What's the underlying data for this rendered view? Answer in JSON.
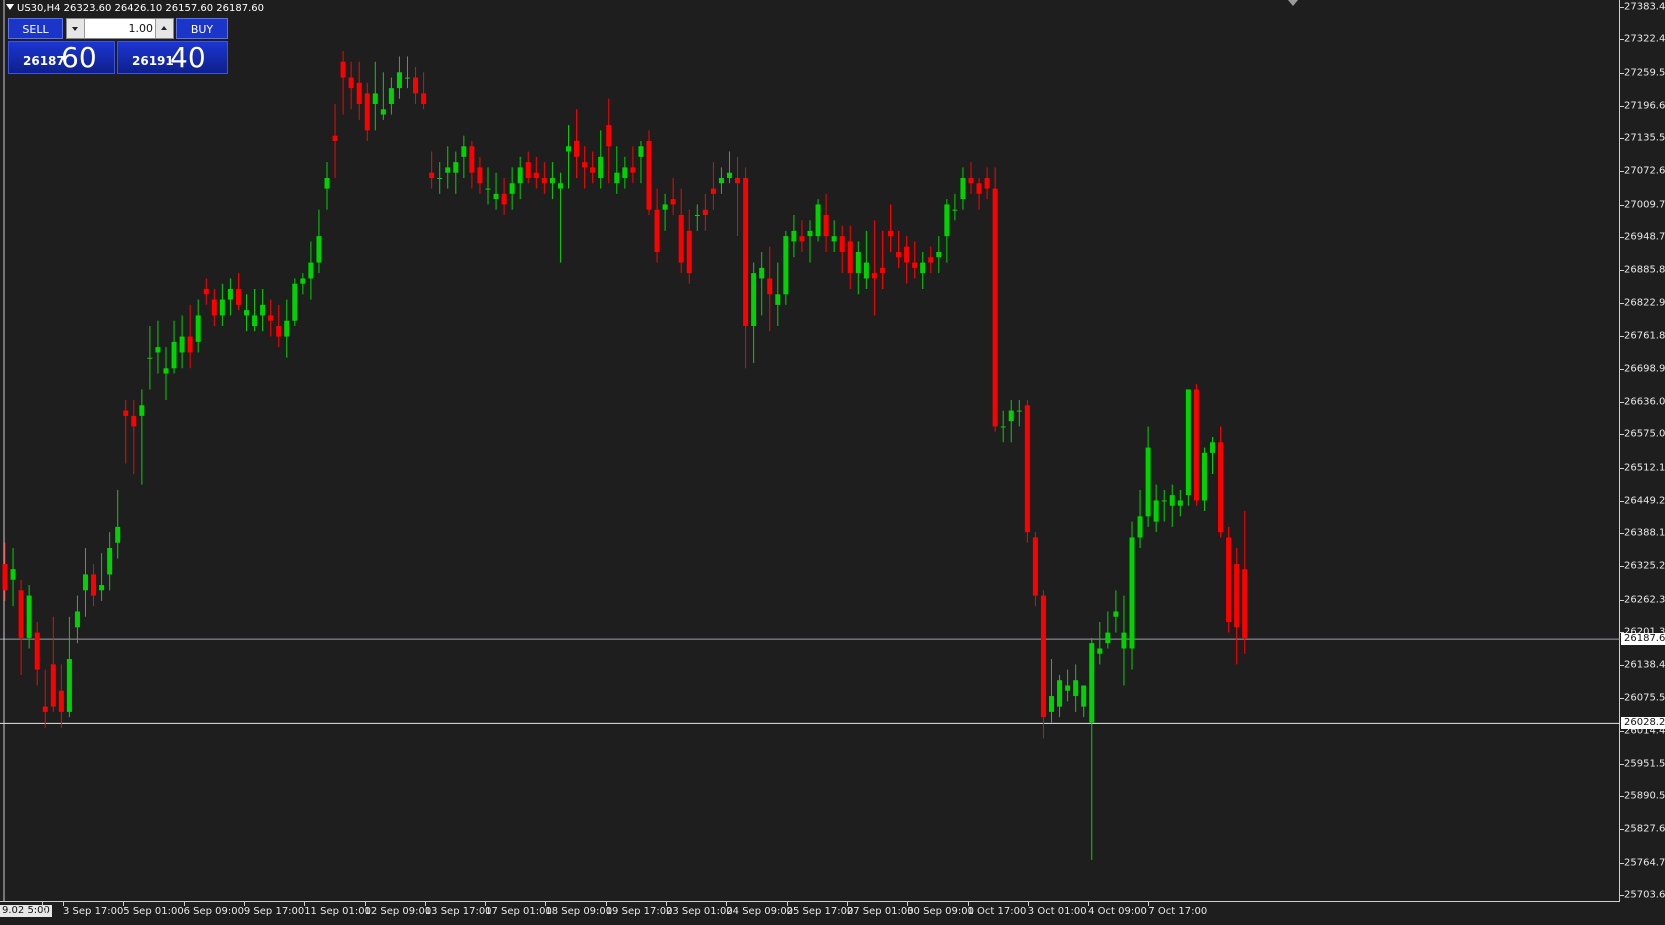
{
  "symbol_info": {
    "text": "US30,H4  26323.60 26426.10 26157.60 26187.60"
  },
  "trade_panel": {
    "sell_label": "SELL",
    "buy_label": "BUY",
    "lot_value": "1.00",
    "sell_price_small": "26187",
    "sell_price_big": "60",
    "buy_price_small": "26191",
    "buy_price_big": "40"
  },
  "colors": {
    "background": "#1e1e1e",
    "bull": "#00d400",
    "bear": "#ff0000",
    "axis": "#cfcfcf",
    "panel_blue": "#1a35c8"
  },
  "period_separator_label": "9.02 5:00",
  "price_axis": {
    "labels": [
      "27383.45",
      "27322.40",
      "27259.50",
      "27196.60",
      "27135.55",
      "27072.60",
      "27009.75",
      "26948.70",
      "26885.80",
      "26822.90",
      "26761.85",
      "26698.95",
      "26636.05",
      "26575.00",
      "26512.10",
      "26449.20",
      "26388.15",
      "26325.25",
      "26262.35",
      "26201.30",
      "26138.40",
      "26075.50",
      "26014.45",
      "25951.55",
      "25890.50",
      "25827.60",
      "25764.70",
      "25703.65"
    ],
    "bid_marker": "26187.60",
    "hline_marker": "26028.28"
  },
  "time_axis": {
    "labels": [
      "9",
      "3 Sep 17:00",
      "5 Sep 01:00",
      "6 Sep 09:00",
      "9 Sep 17:00",
      "11 Sep 01:00",
      "12 Sep 09:00",
      "13 Sep 17:00",
      "17 Sep 01:00",
      "18 Sep 09:00",
      "19 Sep 17:00",
      "23 Sep 01:00",
      "24 Sep 09:00",
      "25 Sep 17:00",
      "27 Sep 01:00",
      "30 Sep 09:00",
      "1 Oct 17:00",
      "3 Oct 01:00",
      "4 Oct 09:00",
      "7 Oct 17:00"
    ]
  },
  "chart_data": {
    "type": "candlestick",
    "symbol": "US30",
    "timeframe": "H4",
    "ylim": [
      25703.65,
      27383.45
    ],
    "horizontal_lines": [
      26187.6,
      26028.28
    ],
    "ohlc": [
      [
        26330,
        26370,
        26260,
        26280
      ],
      [
        26300,
        26360,
        26250,
        26320
      ],
      [
        26280,
        26300,
        26120,
        26190
      ],
      [
        26190,
        26290,
        26170,
        26270
      ],
      [
        26200,
        26220,
        26100,
        26130
      ],
      [
        26060,
        26130,
        26020,
        26050
      ],
      [
        26140,
        26230,
        26050,
        26060
      ],
      [
        26090,
        26140,
        26020,
        26050
      ],
      [
        26050,
        26230,
        26040,
        26150
      ],
      [
        26210,
        26270,
        26180,
        26240
      ],
      [
        26280,
        26360,
        26230,
        26310
      ],
      [
        26310,
        26330,
        26250,
        26270
      ],
      [
        26280,
        26350,
        26260,
        26290
      ],
      [
        26310,
        26390,
        26280,
        26360
      ],
      [
        26370,
        26470,
        26340,
        26400
      ],
      [
        26620,
        26640,
        26520,
        26610
      ],
      [
        26610,
        26640,
        26500,
        26590
      ],
      [
        26610,
        26660,
        26480,
        26630
      ],
      [
        26720,
        26780,
        26660,
        26720
      ],
      [
        26730,
        26790,
        26690,
        26740
      ],
      [
        26690,
        26740,
        26640,
        26700
      ],
      [
        26700,
        26790,
        26690,
        26750
      ],
      [
        26730,
        26800,
        26700,
        26760
      ],
      [
        26760,
        26820,
        26700,
        26730
      ],
      [
        26750,
        26830,
        26730,
        26800
      ],
      [
        26850,
        26870,
        26820,
        26840
      ],
      [
        26830,
        26850,
        26780,
        26800
      ],
      [
        26800,
        26860,
        26780,
        26830
      ],
      [
        26830,
        26870,
        26800,
        26850
      ],
      [
        26850,
        26880,
        26810,
        26820
      ],
      [
        26800,
        26840,
        26770,
        26810
      ],
      [
        26780,
        26850,
        26770,
        26800
      ],
      [
        26800,
        26850,
        26770,
        26820
      ],
      [
        26800,
        26830,
        26760,
        26790
      ],
      [
        26780,
        26820,
        26740,
        26760
      ],
      [
        26760,
        26830,
        26720,
        26790
      ],
      [
        26790,
        26870,
        26780,
        26860
      ],
      [
        26860,
        26880,
        26840,
        26870
      ],
      [
        26870,
        26940,
        26830,
        26900
      ],
      [
        26900,
        27000,
        26880,
        26950
      ],
      [
        27040,
        27090,
        27000,
        27060
      ],
      [
        27140,
        27200,
        27060,
        27130
      ],
      [
        27280,
        27300,
        27180,
        27250
      ],
      [
        27250,
        27280,
        27190,
        27230
      ],
      [
        27240,
        27280,
        27170,
        27200
      ],
      [
        27220,
        27240,
        27130,
        27150
      ],
      [
        27200,
        27280,
        27150,
        27220
      ],
      [
        27180,
        27260,
        27170,
        27190
      ],
      [
        27200,
        27250,
        27180,
        27230
      ],
      [
        27230,
        27290,
        27210,
        27260
      ],
      [
        27250,
        27290,
        27230,
        27250
      ],
      [
        27250,
        27270,
        27200,
        27220
      ],
      [
        27220,
        27260,
        27190,
        27200
      ],
      [
        27070,
        27110,
        27040,
        27060
      ],
      [
        27060,
        27090,
        27030,
        27060
      ],
      [
        27070,
        27120,
        27040,
        27080
      ],
      [
        27070,
        27110,
        27030,
        27090
      ],
      [
        27100,
        27140,
        27060,
        27120
      ],
      [
        27120,
        27130,
        27040,
        27070
      ],
      [
        27080,
        27100,
        27030,
        27050
      ],
      [
        27040,
        27080,
        27010,
        27040
      ],
      [
        27020,
        27070,
        27000,
        27030
      ],
      [
        27030,
        27060,
        26990,
        27010
      ],
      [
        27030,
        27080,
        27000,
        27050
      ],
      [
        27050,
        27100,
        27020,
        27080
      ],
      [
        27090,
        27110,
        27050,
        27060
      ],
      [
        27070,
        27100,
        27040,
        27060
      ],
      [
        27060,
        27090,
        27030,
        27050
      ],
      [
        27050,
        27090,
        27020,
        27060
      ],
      [
        27040,
        27070,
        26900,
        27050
      ],
      [
        27110,
        27160,
        27040,
        27120
      ],
      [
        27130,
        27190,
        27060,
        27100
      ],
      [
        27090,
        27120,
        27040,
        27080
      ],
      [
        27080,
        27110,
        27050,
        27070
      ],
      [
        27060,
        27150,
        27040,
        27100
      ],
      [
        27160,
        27210,
        27050,
        27120
      ],
      [
        27050,
        27120,
        27030,
        27070
      ],
      [
        27060,
        27100,
        27040,
        27080
      ],
      [
        27080,
        27120,
        27050,
        27070
      ],
      [
        27100,
        27130,
        27050,
        27120
      ],
      [
        27130,
        27150,
        26990,
        27000
      ],
      [
        27000,
        27040,
        26900,
        26920
      ],
      [
        27000,
        27030,
        26960,
        27010
      ],
      [
        27020,
        27060,
        26990,
        27010
      ],
      [
        26990,
        27040,
        26880,
        26900
      ],
      [
        26960,
        27000,
        26860,
        26880
      ],
      [
        26990,
        27010,
        26960,
        26990
      ],
      [
        27000,
        27030,
        26960,
        26990
      ],
      [
        27040,
        27090,
        27000,
        27030
      ],
      [
        27050,
        27080,
        27030,
        27060
      ],
      [
        27060,
        27110,
        27050,
        27070
      ],
      [
        27060,
        27100,
        26950,
        27050
      ],
      [
        27060,
        27080,
        26700,
        26780
      ],
      [
        26780,
        26900,
        26710,
        26880
      ],
      [
        26870,
        26920,
        26800,
        26890
      ],
      [
        26870,
        26930,
        26770,
        26840
      ],
      [
        26820,
        26900,
        26780,
        26840
      ],
      [
        26840,
        26960,
        26820,
        26950
      ],
      [
        26940,
        26990,
        26910,
        26960
      ],
      [
        26950,
        26980,
        26920,
        26940
      ],
      [
        26950,
        26980,
        26900,
        26960
      ],
      [
        26950,
        27020,
        26940,
        27010
      ],
      [
        26990,
        27030,
        26920,
        26950
      ],
      [
        26940,
        26980,
        26920,
        26950
      ],
      [
        26950,
        26970,
        26880,
        26920
      ],
      [
        26940,
        26970,
        26850,
        26880
      ],
      [
        26880,
        26940,
        26840,
        26920
      ],
      [
        26870,
        26960,
        26850,
        26900
      ],
      [
        26880,
        26980,
        26800,
        26870
      ],
      [
        26890,
        26960,
        26850,
        26880
      ],
      [
        26960,
        27010,
        26920,
        26950
      ],
      [
        26920,
        26960,
        26890,
        26910
      ],
      [
        26930,
        26950,
        26860,
        26900
      ],
      [
        26900,
        26940,
        26870,
        26890
      ],
      [
        26880,
        26920,
        26850,
        26900
      ],
      [
        26910,
        26930,
        26880,
        26900
      ],
      [
        26910,
        26950,
        26880,
        26920
      ],
      [
        26950,
        27020,
        26900,
        27010
      ],
      [
        27000,
        27030,
        26980,
        27000
      ],
      [
        27020,
        27080,
        27000,
        27060
      ],
      [
        27060,
        27090,
        27030,
        27050
      ],
      [
        27050,
        27060,
        27000,
        27030
      ],
      [
        27060,
        27080,
        27020,
        27040
      ],
      [
        27040,
        27080,
        26580,
        26590
      ],
      [
        26590,
        26620,
        26560,
        26590
      ],
      [
        26600,
        26640,
        26560,
        26620
      ],
      [
        26620,
        26640,
        26590,
        26620
      ],
      [
        26630,
        26640,
        26370,
        26390
      ],
      [
        26380,
        26390,
        26250,
        26270
      ],
      [
        26270,
        26280,
        26000,
        26040
      ],
      [
        26050,
        26150,
        26030,
        26080
      ],
      [
        26060,
        26120,
        26040,
        26110
      ],
      [
        26090,
        26130,
        26070,
        26100
      ],
      [
        26080,
        26140,
        26050,
        26110
      ],
      [
        26060,
        26100,
        26040,
        26100
      ],
      [
        26030,
        26190,
        25770,
        26180
      ],
      [
        26160,
        26220,
        26140,
        26170
      ],
      [
        26180,
        26240,
        26170,
        26200
      ],
      [
        26230,
        26280,
        26200,
        26240
      ],
      [
        26170,
        26270,
        26100,
        26200
      ],
      [
        26170,
        26410,
        26130,
        26380
      ],
      [
        26380,
        26470,
        26360,
        26420
      ],
      [
        26420,
        26590,
        26400,
        26550
      ],
      [
        26410,
        26480,
        26390,
        26450
      ],
      [
        26450,
        26470,
        26410,
        26450
      ],
      [
        26440,
        26480,
        26400,
        26460
      ],
      [
        26440,
        26470,
        26420,
        26450
      ],
      [
        26460,
        26600,
        26440,
        26660
      ],
      [
        26660,
        26670,
        26440,
        26450
      ],
      [
        26450,
        26550,
        26430,
        26540
      ],
      [
        26540,
        26570,
        26500,
        26560
      ],
      [
        26560,
        26590,
        26380,
        26390
      ],
      [
        26380,
        26400,
        26200,
        26220
      ],
      [
        26330,
        26360,
        26140,
        26210
      ],
      [
        26320,
        26430,
        26160,
        26190
      ]
    ]
  }
}
